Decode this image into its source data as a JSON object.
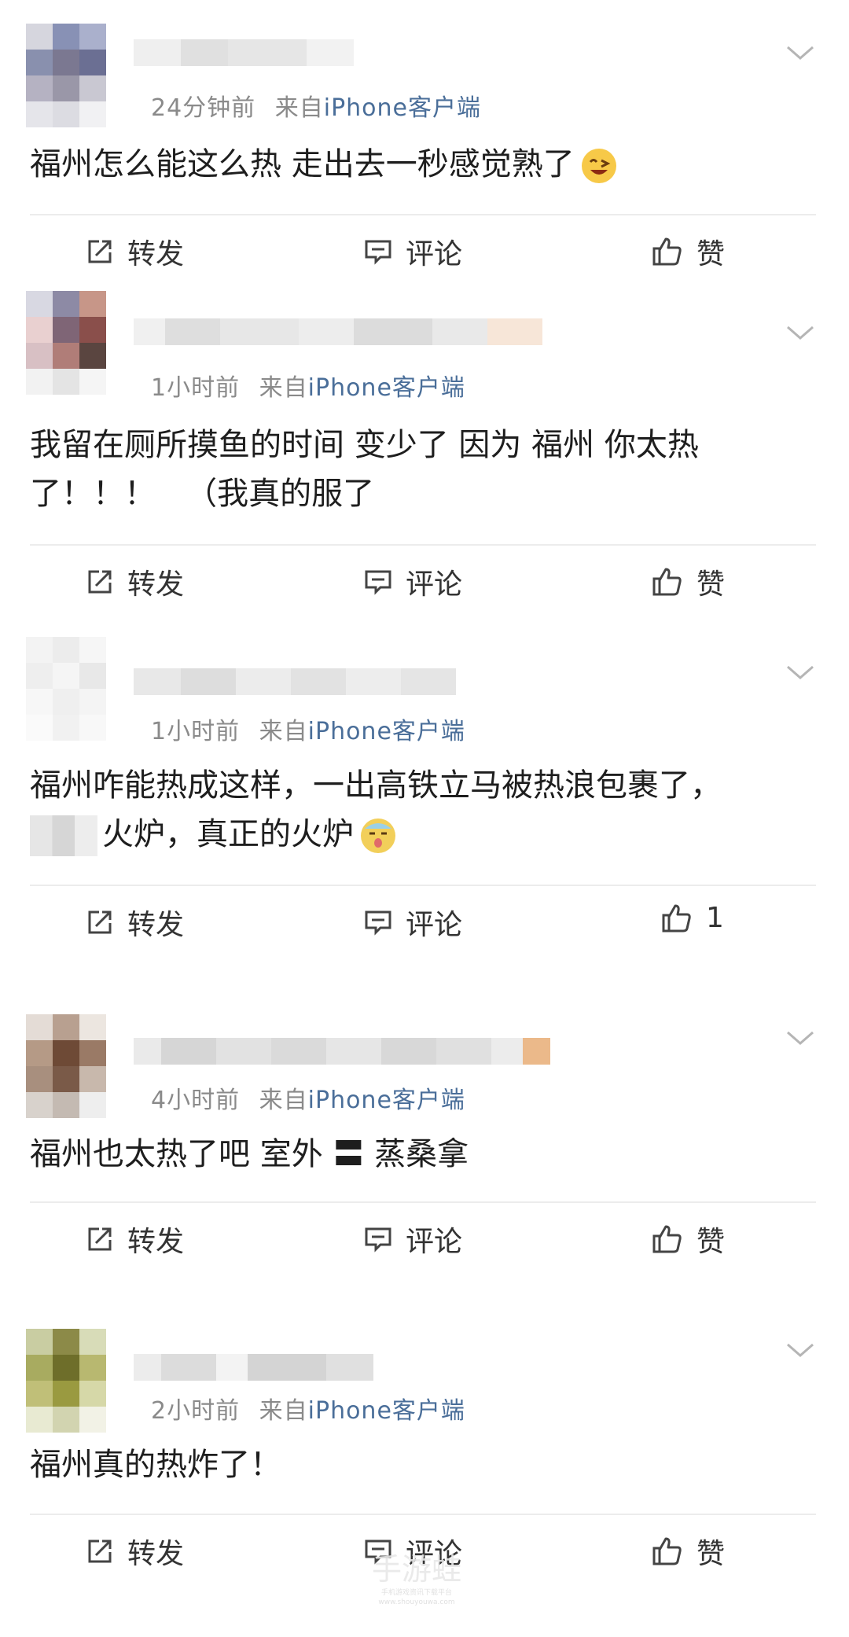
{
  "posts": [
    {
      "time": "24分钟前",
      "from": "来自",
      "source": "iPhone客户端",
      "text1": "福州怎么能这么热 走出去一秒感觉熟了",
      "text2": "",
      "forward": "转发",
      "comment": "评论",
      "like": "赞"
    },
    {
      "time": "1小时前",
      "from": "来自",
      "source": "iPhone客户端",
      "text1": "我留在厕所摸鱼的时间 变少了 因为 福州 你太热",
      "text2": "了！！！   （我真的服了",
      "forward": "转发",
      "comment": "评论",
      "like": "赞"
    },
    {
      "time": "1小时前",
      "from": "来自",
      "source": "iPhone客户端",
      "text1": "福州咋能热成这样，一出高铁立马被热浪包裹了，",
      "text2": "火炉，真正的火炉",
      "forward": "转发",
      "comment": "评论",
      "like": "1"
    },
    {
      "time": "4小时前",
      "from": "来自",
      "source": "iPhone客户端",
      "text1": "福州也太热了吧 室外 〓 蒸桑拿",
      "text2": "",
      "forward": "转发",
      "comment": "评论",
      "like": "赞"
    },
    {
      "time": "2小时前",
      "from": "来自",
      "source": "iPhone客户端",
      "text1": "福州真的热炸了！",
      "text2": "",
      "forward": "转发",
      "comment": "评论",
      "like": "赞"
    }
  ],
  "watermark": {
    "main": "手游蛙",
    "sub1": "手机游戏资讯下载平台",
    "sub2": "www.shouyouwa.com"
  },
  "colors": {
    "source_link": "#4a6e99",
    "meta": "#8a8a8a",
    "divider": "#ececec"
  }
}
